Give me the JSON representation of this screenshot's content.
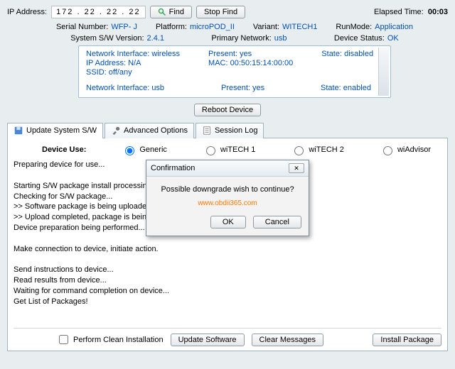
{
  "top": {
    "ip_label": "IP Address:",
    "ip_value": "172 . 22 . 22 . 22",
    "find": "Find",
    "stop_find": "Stop Find",
    "elapsed_label": "Elapsed Time:",
    "elapsed_value": "00:03"
  },
  "info1": {
    "serial_label": "Serial Number:",
    "serial_value": "WFP-     J",
    "platform_label": "Platform:",
    "platform_value": "microPOD_II",
    "variant_label": "Variant:",
    "variant_value": "WITECH1",
    "runmode_label": "RunMode:",
    "runmode_value": "Application"
  },
  "info2": {
    "sw_label": "System S/W Version:",
    "sw_value": "2.4.1",
    "net_label": "Primary Network:",
    "net_value": "usb",
    "status_label": "Device Status:",
    "status_value": "OK"
  },
  "net": {
    "wireless1": "Network Interface: wireless",
    "wireless2": "IP Address: N/A",
    "wireless3": "SSID: off/any",
    "present_label": "Present: yes",
    "mac": "MAC: 00:50:15:14:00:00",
    "state_disabled": "State: disabled",
    "usb_if": "Network Interface: usb",
    "usb_present": "Present: yes",
    "usb_state": "State: enabled"
  },
  "reboot": "Reboot Device",
  "tabs": {
    "t1": "Update System S/W",
    "t2": "Advanced Options",
    "t3": "Session Log"
  },
  "device_use": {
    "label": "Device Use:",
    "generic": "Generic",
    "w1": "wiTECH 1",
    "w2": "wiTECH 2",
    "wa": "wiAdvisor"
  },
  "log_text": "Preparing device for use...\n\nStarting S/W package install processing...\nChecking for S/W package...\n   >> Software package is being uploaded to devi\n   >> Upload completed, package is being installe\nDevice preparation being performed...\n\nMake connection to device, initiate action.\n\nSend instructions to device...\nRead results from device...\nWaiting for command completion on device...\nGet List of Packages!",
  "bottom": {
    "clean": "Perform Clean Installation",
    "update": "Update Software",
    "clear": "Clear Messages",
    "install": "Install Package"
  },
  "modal": {
    "title": "Confirmation",
    "body": "Possible downgrade wish to continue?",
    "watermark": "www.obdii365.com",
    "ok": "OK",
    "cancel": "Cancel"
  }
}
